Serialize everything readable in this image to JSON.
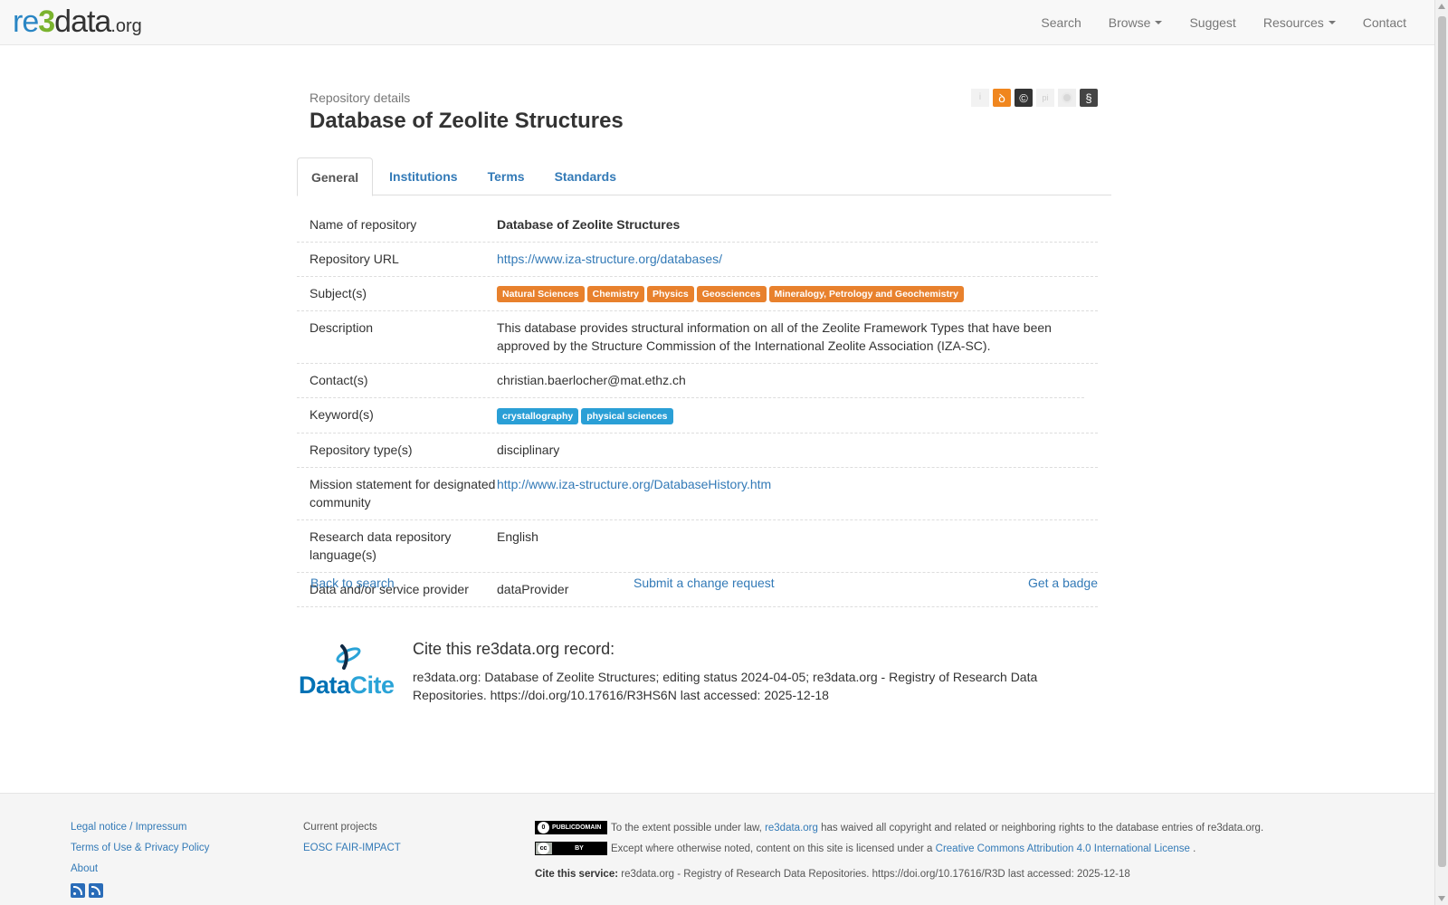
{
  "navbar": {
    "logo": {
      "part_re": "re",
      "part_3": "3",
      "part_data": "data",
      "part_org": ".org"
    },
    "items": [
      {
        "label": "Search",
        "dropdown": false
      },
      {
        "label": "Browse",
        "dropdown": true
      },
      {
        "label": "Suggest",
        "dropdown": false
      },
      {
        "label": "Resources",
        "dropdown": true
      },
      {
        "label": "Contact",
        "dropdown": false
      }
    ]
  },
  "header": {
    "eyebrow": "Repository details",
    "title": "Database of Zeolite Structures",
    "license_icons": [
      {
        "icon": "info-icon",
        "glyph": "i"
      },
      {
        "icon": "open-access-icon",
        "glyph": "ꝺ"
      },
      {
        "icon": "copyright-icon",
        "glyph": "©"
      },
      {
        "icon": "pid-icon",
        "glyph": "pi"
      },
      {
        "icon": "certificate-icon",
        "glyph": ""
      },
      {
        "icon": "policy-icon",
        "glyph": "§"
      }
    ]
  },
  "tabs": [
    {
      "label": "General",
      "active": true
    },
    {
      "label": "Institutions",
      "active": false
    },
    {
      "label": "Terms",
      "active": false
    },
    {
      "label": "Standards",
      "active": false
    }
  ],
  "details": {
    "name_label": "Name of repository",
    "name_value": "Database of Zeolite Structures",
    "url_label": "Repository URL",
    "url_value": "https://www.iza-structure.org/databases/",
    "subjects_label": "Subject(s)",
    "subjects": [
      "Natural Sciences",
      "Chemistry",
      "Physics",
      "Geosciences",
      "Mineralogy, Petrology and Geochemistry"
    ],
    "description_label": "Description",
    "description_value": "This database provides structural information on all of the Zeolite Framework Types that have been approved by the Structure Commission of the International Zeolite Association (IZA-SC).",
    "contacts_label": "Contact(s)",
    "contacts_value": "christian.baerlocher@mat.ethz.ch",
    "keywords_label": "Keyword(s)",
    "keywords": [
      "crystallography",
      "physical sciences"
    ],
    "repo_type_label": "Repository type(s)",
    "repo_type_value": "disciplinary",
    "mission_label": "Mission statement for designated community",
    "mission_value": "http://www.iza-structure.org/DatabaseHistory.htm",
    "language_label": "Research data repository language(s)",
    "language_value": "English",
    "provider_label": "Data and/or service provider",
    "provider_value": "dataProvider"
  },
  "actions": {
    "back": "Back to search",
    "change": "Submit a change request",
    "badge": "Get a badge"
  },
  "cite": {
    "logo_part1": "Data",
    "logo_part2": "Cite",
    "title": "Cite this re3data.org record:",
    "body": "re3data.org: Database of Zeolite Structures; editing status 2024-04-05; re3data.org - Registry of Research Data Repositories. https://doi.org/10.17616/R3HS6N last accessed: 2025-12-18"
  },
  "footer": {
    "col1": [
      "Legal notice / Impressum",
      "Terms of Use & Privacy Policy",
      "About"
    ],
    "col2_heading": "Current projects",
    "col2_link": "EOSC FAIR-IMPACT",
    "pd_badge": "PUBLICDOMAIN",
    "pd_text_1": "To the extent possible under law,",
    "pd_link": "re3data.org",
    "pd_text_2": "has waived all copyright and related or neighboring rights to the database entries of re3data.org.",
    "cc_badge_left": "cc",
    "cc_badge_right": "BY",
    "cc_text": "Except where otherwise noted, content on this site is licensed under a",
    "cc_link": "Creative Commons Attribution 4.0 International License",
    "cc_period": ".",
    "cite_service_label": "Cite this service:",
    "cite_service_text": "re3data.org - Registry of Research Data Repositories. https://doi.org/10.17616/R3D last accessed: 2025-12-18"
  },
  "colors": {
    "link": "#337ab7",
    "subject_tag": "#e8812d",
    "keyword_tag": "#2a9fd6",
    "logo_blue": "#2a86c4",
    "logo_green": "#7ab32e"
  }
}
